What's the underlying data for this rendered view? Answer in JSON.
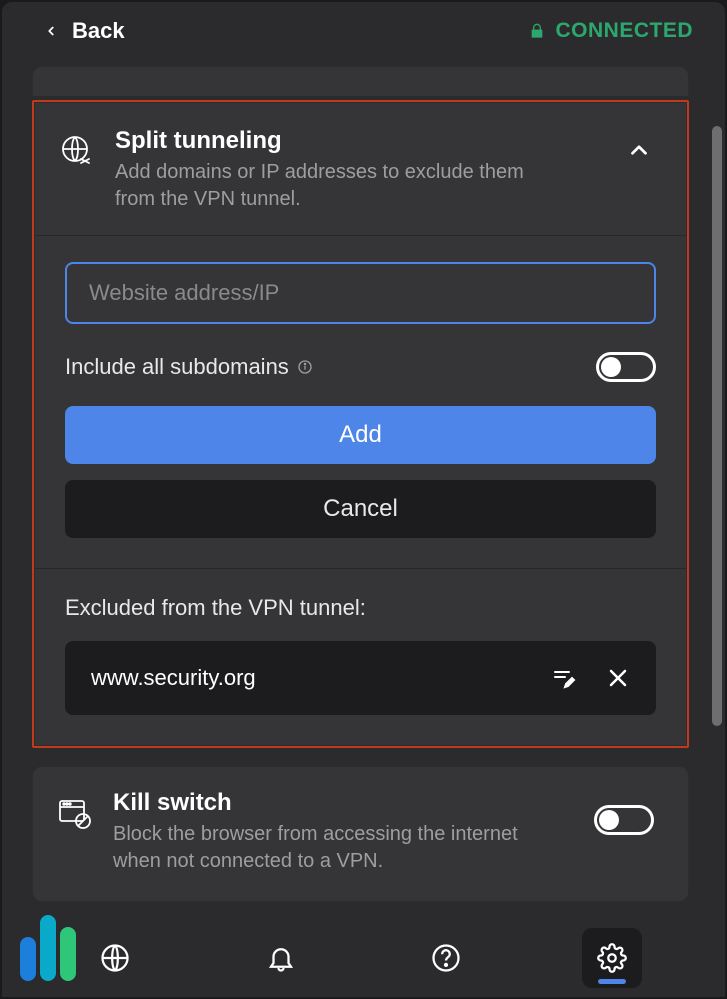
{
  "header": {
    "back_label": "Back",
    "connection_status": "CONNECTED"
  },
  "split_tunneling": {
    "title": "Split tunneling",
    "description": "Add domains or IP addresses to exclude them from the VPN tunnel.",
    "input_placeholder": "Website address/IP",
    "input_value": "",
    "subdomains_label": "Include all subdomains",
    "subdomains_enabled": false,
    "add_label": "Add",
    "cancel_label": "Cancel",
    "excluded_title": "Excluded from the VPN tunnel:",
    "excluded_items": [
      {
        "domain": "www.security.org"
      }
    ]
  },
  "kill_switch": {
    "title": "Kill switch",
    "description": "Block the browser from accessing the internet when not connected to a VPN.",
    "enabled": false
  },
  "icons": {
    "globe_tunnel": "globe-tunnel-icon",
    "browser_block": "browser-block-icon"
  },
  "colors": {
    "accent": "#4d85e8",
    "connected": "#2ca86e",
    "highlight_border": "#c23a1e",
    "panel_bg": "#353538",
    "app_bg": "#2b2b2e"
  }
}
